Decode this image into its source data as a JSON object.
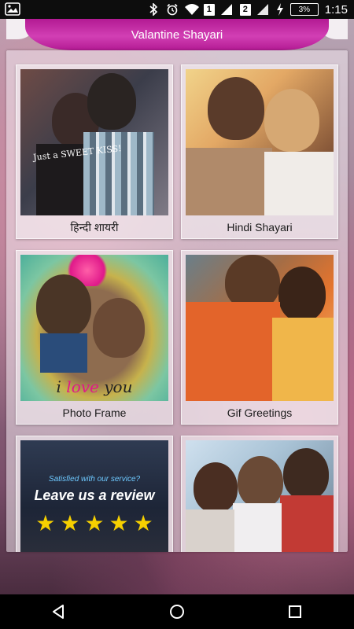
{
  "status_bar": {
    "sim1": "1",
    "sim2": "2",
    "battery": "3%",
    "time": "1:15",
    "icons": [
      "app-notification-icon",
      "bluetooth-icon",
      "alarm-icon",
      "wifi-icon",
      "signal-icon",
      "charging-icon",
      "battery-icon"
    ]
  },
  "header": {
    "title": "Valantine Shayari"
  },
  "menu": {
    "items": [
      {
        "label": "हिन्दी शायरी",
        "image_text": "Just a SWEET KISS!"
      },
      {
        "label": "Hindi Shayari"
      },
      {
        "label": "Photo Frame",
        "image_text_1": "i ",
        "image_text_2": "love",
        "image_text_3": " you"
      },
      {
        "label": "Gif Greetings"
      },
      {
        "label": "",
        "review_sub": "Satisfied with our service?",
        "review_main": "Leave us a review",
        "stars": 5
      },
      {
        "label": ""
      }
    ]
  },
  "navbar": {
    "icons": [
      "back-icon",
      "home-icon",
      "recents-icon"
    ]
  },
  "colors": {
    "header": "#c12aa3",
    "status_bar": "#0d0d0d",
    "nav_bar": "#000000",
    "star": "#f6d000"
  }
}
